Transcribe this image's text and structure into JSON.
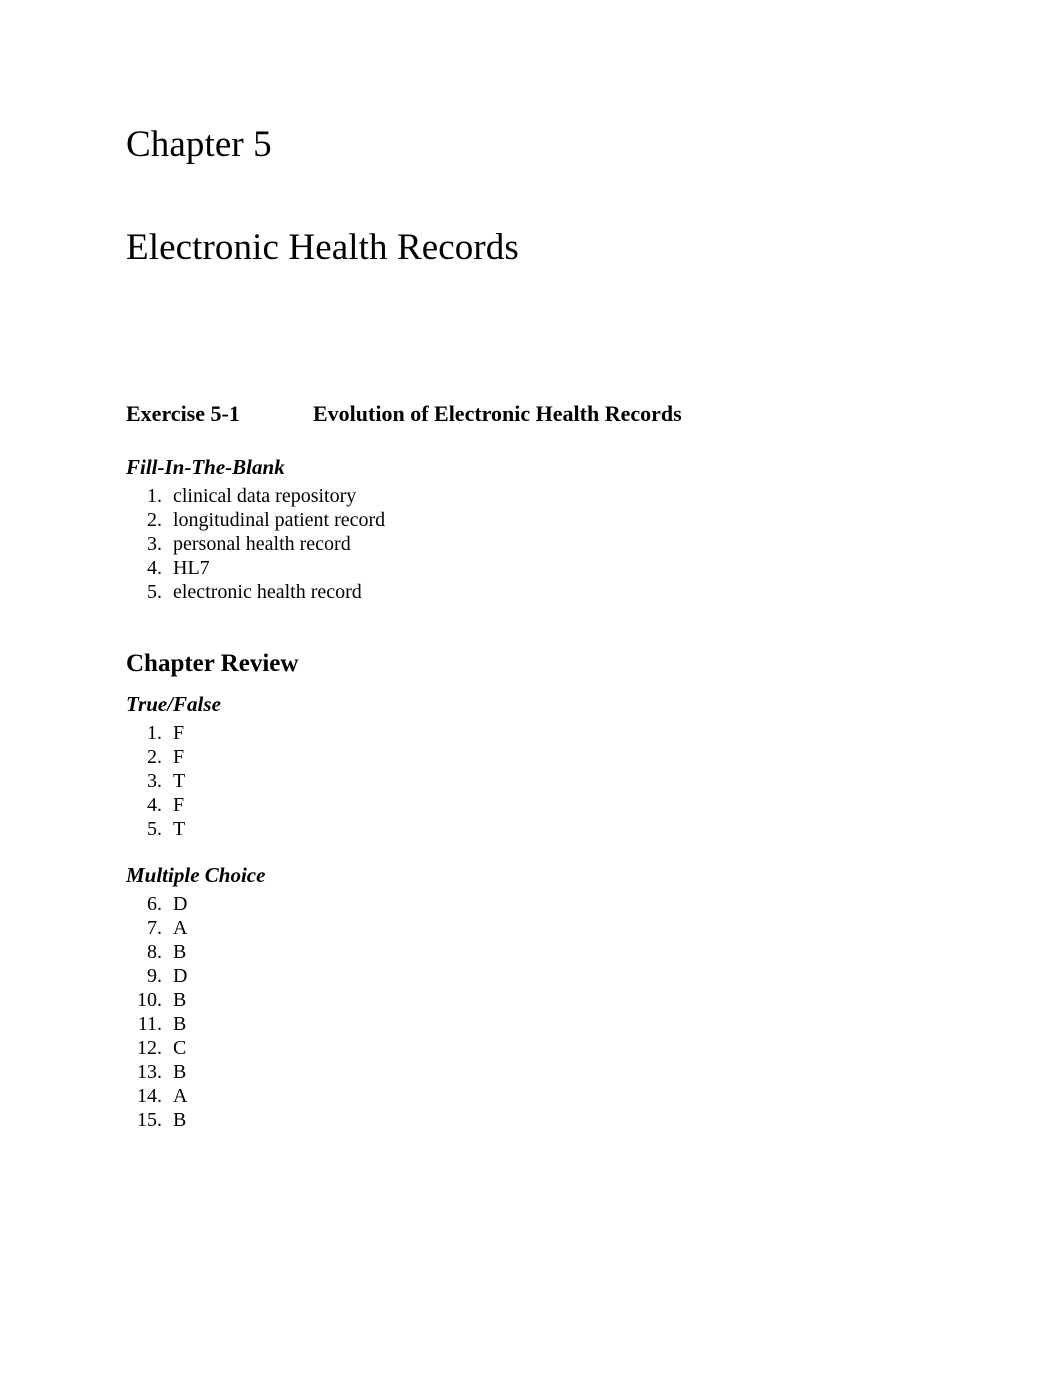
{
  "document": {
    "chapter_label": "Chapter 5",
    "chapter_title": "Electronic Health Records"
  },
  "exercise": {
    "label": "Exercise 5-1",
    "title": "Evolution of Electronic Health Records",
    "fill_in_the_blank": {
      "heading": "Fill-In-The-Blank",
      "items": [
        {
          "num": "1.",
          "answer": "clinical data repository"
        },
        {
          "num": "2.",
          "answer": "longitudinal patient record"
        },
        {
          "num": "3.",
          "answer": "personal health record"
        },
        {
          "num": "4.",
          "answer": "HL7"
        },
        {
          "num": "5.",
          "answer": "electronic health record"
        }
      ]
    }
  },
  "chapter_review": {
    "heading": "Chapter Review",
    "true_false": {
      "heading": "True/False",
      "items": [
        {
          "num": "1.",
          "answer": "F"
        },
        {
          "num": "2.",
          "answer": "F"
        },
        {
          "num": "3.",
          "answer": "T"
        },
        {
          "num": "4.",
          "answer": "F"
        },
        {
          "num": "5.",
          "answer": "T"
        }
      ]
    },
    "multiple_choice": {
      "heading": "Multiple Choice",
      "items": [
        {
          "num": "6.",
          "answer": "D"
        },
        {
          "num": "7.",
          "answer": "A"
        },
        {
          "num": "8.",
          "answer": "B"
        },
        {
          "num": "9.",
          "answer": "D"
        },
        {
          "num": "10.",
          "answer": "B"
        },
        {
          "num": "11.",
          "answer": "B"
        },
        {
          "num": "12.",
          "answer": "C"
        },
        {
          "num": "13.",
          "answer": "B"
        },
        {
          "num": "14.",
          "answer": "A"
        },
        {
          "num": "15.",
          "answer": "B"
        }
      ]
    }
  },
  "colors": {
    "page_background": "#ffffff",
    "text": "#000000"
  }
}
